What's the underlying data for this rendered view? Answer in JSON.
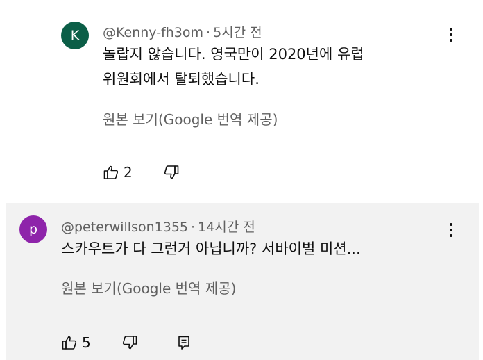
{
  "comments": [
    {
      "avatar_letter": "K",
      "avatar_color": "#0b5e47",
      "author": "@Kenny-fh3om",
      "separator": "·",
      "time": "5시간 전",
      "text": "놀랍지 않습니다. 영국만이 2020년에 유럽\n위원회에서 탈퇴했습니다.",
      "translate_label": "원본 보기(Google 번역 제공)",
      "like_count": "2"
    },
    {
      "avatar_letter": "p",
      "avatar_color": "#8e24aa",
      "author": "@peterwillson1355",
      "separator": "·",
      "time": "14시간 전",
      "text": "스카우트가 다 그런거 아닙니까? 서바이벌 미션...",
      "translate_label": "원본 보기(Google 번역 제공)",
      "like_count": "5"
    }
  ],
  "icons": {
    "like": "thumb-up-icon",
    "dislike": "thumb-down-icon",
    "reply": "reply-icon",
    "menu": "more-vert-icon"
  }
}
